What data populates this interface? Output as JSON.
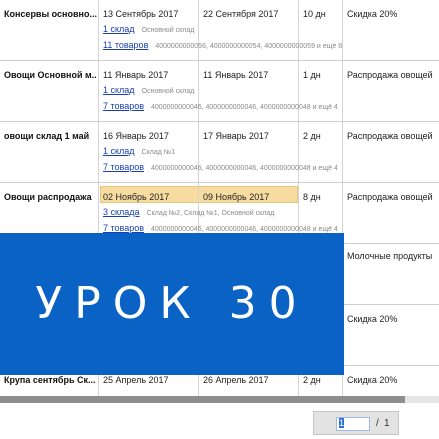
{
  "rows": [
    {
      "name": "Консервы основно...",
      "start": "13 Сентябрь 2017",
      "end": "22 Сентября 2017",
      "days": "10 дн",
      "promo": "Скидка 20%",
      "warehouses_link": "1 склад",
      "warehouses_detail": "Основной склад",
      "goods_link": "11 товаров",
      "goods_detail": "4000000000056, 4000000000054, 4000000000059 и ещё 8"
    },
    {
      "name": "Овощи Основной м...",
      "start": "11 Январь 2017",
      "end": "11 Январь 2017",
      "days": "1 дн",
      "promo": "Распродажа овощей",
      "warehouses_link": "1 склад",
      "warehouses_detail": "Основной склад",
      "goods_link": "7 товаров",
      "goods_detail": "4000000000046, 4000000000046, 4000000000048 и ещё 4"
    },
    {
      "name": "овощи склад 1 май",
      "start": "16 Январь 2017",
      "end": "17 Январь 2017",
      "days": "2 дн",
      "promo": "Распродажа овощей",
      "warehouses_link": "1 склад",
      "warehouses_detail": "Склад №1",
      "goods_link": "7 товаров",
      "goods_detail": "4000000000046, 4000000000046, 4000000000048 и ещё 4"
    },
    {
      "name": "Овощи распродажа",
      "start": "02 Ноябрь 2017",
      "end": "09 Ноябрь 2017",
      "days": "8 дн",
      "promo": "Распродажа овощей",
      "warehouses_link": "3 склада",
      "warehouses_detail": "Склад №2, Склад №1, Основной склад",
      "goods_link": "7 товаров",
      "goods_detail": "4000000000046, 4000000000046, 4000000000048 и ещё 4"
    }
  ],
  "partial": {
    "promo_row5": "Молочные продукты",
    "promo_row6": "Скидка 20%"
  },
  "last_row": {
    "name": "Крупа сентябрь Ск...",
    "start": "25 Апрель 2017",
    "end": "26 Апрель 2017",
    "days": "2 дн",
    "promo": "Скидка 20%"
  },
  "banner": {
    "text": "УРОК 30"
  },
  "pager": {
    "current": "1",
    "separator": "/",
    "total": "1"
  }
}
